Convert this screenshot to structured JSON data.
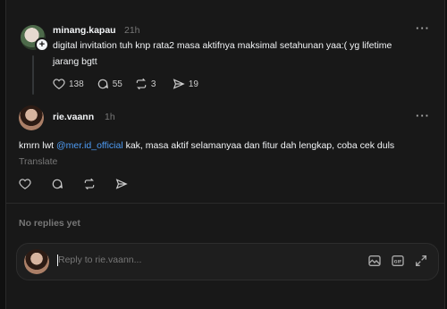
{
  "post1": {
    "username": "minang.kapau",
    "time": "21h",
    "text": "digital invitation tuh knp rata2 masa aktifnya maksimal setahunan yaa:( yg lifetime jarang bgtt",
    "likes": "138",
    "comments": "55",
    "reposts": "3",
    "shares": "19",
    "icons": [
      "heart-icon",
      "comment-icon",
      "repost-icon",
      "share-icon"
    ]
  },
  "post2": {
    "username": "rie.vaann",
    "time": "1h",
    "text_before": "kmrn lwt ",
    "mention": "@mer.id_official",
    "text_after": " kak, masa aktif selamanyaa dan fitur dah lengkap, coba cek duls",
    "translate": "Translate"
  },
  "replies": {
    "empty_label": "No replies yet"
  },
  "composer": {
    "placeholder": "Reply to rie.vaann...",
    "icons": [
      "image-icon",
      "gif-icon",
      "expand-icon"
    ]
  },
  "colors": {
    "background": "#181818",
    "mention": "#4e9cf5",
    "muted": "#777777"
  }
}
